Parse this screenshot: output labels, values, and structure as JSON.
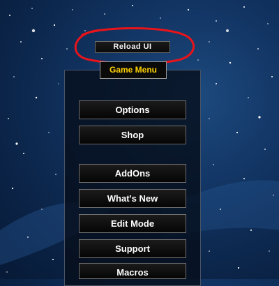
{
  "reload": {
    "label": "Reload UI"
  },
  "menu": {
    "title": "Game Menu",
    "items": [
      {
        "label": "Options"
      },
      {
        "label": "Shop"
      },
      {
        "label": "AddOns"
      },
      {
        "label": "What's New"
      },
      {
        "label": "Edit Mode"
      },
      {
        "label": "Support"
      },
      {
        "label": "Macros"
      }
    ]
  },
  "colors": {
    "title_text": "#ffd100",
    "annotation_circle": "#e8141a"
  }
}
